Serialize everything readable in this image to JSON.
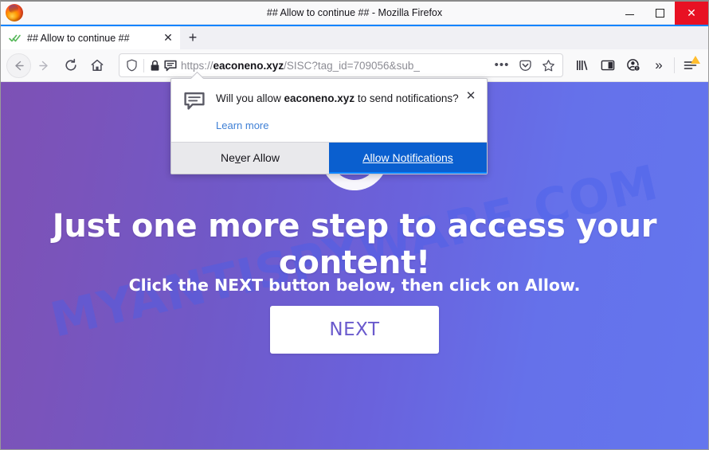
{
  "window": {
    "title": "## Allow to continue ## - Mozilla Firefox",
    "minimize_label": "Minimize",
    "maximize_label": "Maximize",
    "close_label": "Close"
  },
  "tabs": {
    "active": {
      "label": "## Allow to continue ##",
      "favicon": "green-double-check-icon",
      "close_glyph": "✕"
    },
    "new_tab_glyph": "+"
  },
  "toolbar": {
    "back_label": "Back",
    "forward_label": "Forward",
    "reload_label": "Reload",
    "home_label": "Home",
    "library_label": "Library",
    "sidebar_label": "Sidebar",
    "account_label": "Account",
    "overflow_glyph": "»",
    "menu_label": "Open menu",
    "menu_badge": "update-warning"
  },
  "urlbar": {
    "scheme": "https://",
    "domain": "eaconeno.xyz",
    "path": "/SISC?tag_id=709056&sub_",
    "full_url": "https://eaconeno.xyz/SISC?tag_id=709056&sub_",
    "shield_icon": "shield-icon",
    "lock_icon": "padlock-icon",
    "notification_icon": "notification-bubble-icon",
    "page_actions_glyph": "•••",
    "pocket_icon": "pocket-icon",
    "bookmark_icon": "star-icon"
  },
  "permission_popup": {
    "icon": "speech-bubble-icon",
    "question_prefix": "Will you allow ",
    "question_domain": "eaconeno.xyz",
    "question_suffix": " to send notifications?",
    "learn_more": "Learn more",
    "close_glyph": "✕",
    "never_allow_pre": "Ne",
    "never_allow_accesskey": "v",
    "never_allow_post": "er Allow",
    "allow_label": "Allow Notifications",
    "primary_color": "#0a5fcf"
  },
  "page": {
    "watermark": "MYANTISPYWARE.COM",
    "spinner": "loading-spinner",
    "headline": "Just one more step to access your content!",
    "subline": "Click the NEXT button below, then click on Allow.",
    "next_button": "NEXT",
    "gradient_start": "#7d51b5",
    "gradient_end": "#6476ee",
    "next_text_color": "#6a5acd"
  }
}
